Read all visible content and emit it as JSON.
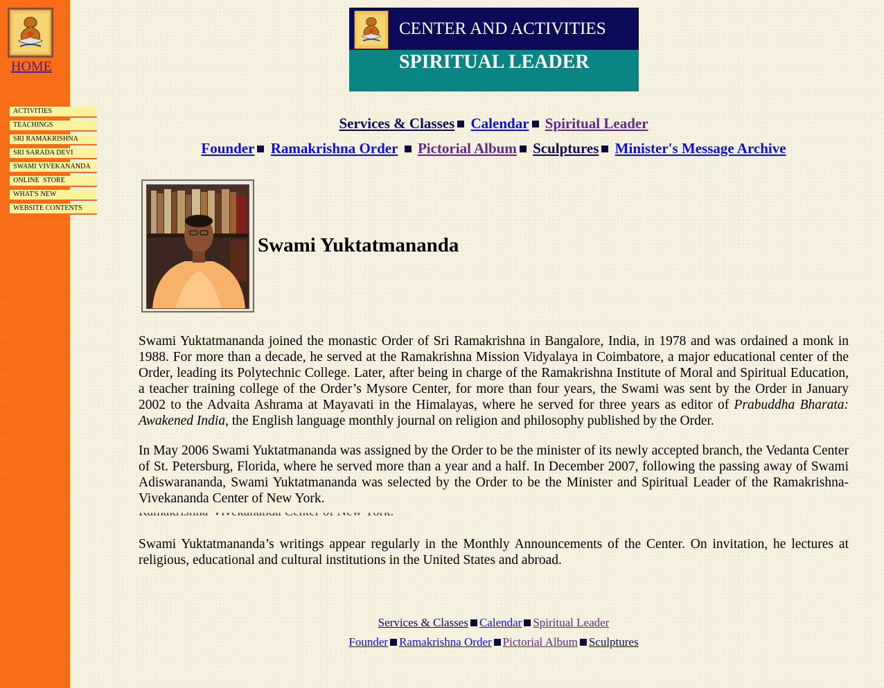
{
  "sidebar": {
    "home_label": "HOME",
    "menu": [
      "ACTIVITIES",
      "TEACHINGS",
      "SRI RAMAKRISHNA",
      "SRI SARADA DEVI",
      "SWAMI VIVEKANANDA",
      "ONLINE  STORE",
      "WHAT'S NEW",
      "WEBSITE CONTENTS"
    ]
  },
  "banner": {
    "line1": "CENTER AND ACTIVITIES",
    "line2": "SPIRITUAL LEADER"
  },
  "nav": {
    "services": "Services & Classes",
    "calendar": "Calendar",
    "spiritual_leader": "Spiritual Leader",
    "founder": "Founder",
    "ramakrishna_order": "Ramakrishna Order",
    "pictorial_album": "Pictorial Album",
    "sculptures": "Sculptures",
    "ministers_archive": "Minister's Message Archive"
  },
  "profile": {
    "name": "Swami Yuktatmananda"
  },
  "body": {
    "p1_a": "Swami Yuktatmananda joined the monastic Order of Sri Ramakrishna in Bangalore, India, in 1978 and was ordained a monk in 1988. For more than a decade, he served at the Ramakrishna Mission Vidyalaya in Coimbatore, a major educational center of the Order, leading its Polytechnic College. Later, after being in charge of the Ramakrishna Institute of Moral and Spiritual Education, a teacher training college of the Order’s Mysore Center, for more than four years, the Swami was sent by the Order in January 2002 to the Advaita Ashrama at Mayavati in the Himalayas, where he served for three years as editor of ",
    "p1_italic": "Prabuddha Bharata: Awakened India",
    "p1_b": ", the English language monthly journal on religion and philosophy published by the Order.",
    "p2": "In May 2006 Swami Yuktatmananda was assigned by the Order to be the minister of its newly accepted branch, the Vedanta Center of St. Petersburg, Florida, where he served more than a year and a half. In December 2007, following the passing away of Swami Adiswarananda, Swami Yuktatmananda was selected by the Order to be the Minister and Spiritual Leader of the Ramakrishna-Vivekananda Center of New York.",
    "ghost": "Ramakrishna-Vivekananda Center of New York.",
    "p3": "Swami Yuktatmananda’s writings appear regularly in the Monthly Announcements of the Center. On invitation, he lectures at religious, educational and cultural institutions in the United States and abroad."
  },
  "footer": {
    "services": "Services & Classes",
    "calendar": "Calendar",
    "spiritual_leader": "Spiritual Leader",
    "founder": "Founder",
    "ramakrishna_order": "Ramakrishna Order",
    "pictorial_album": "Pictorial Album",
    "sculptures": "Sculptures"
  },
  "colors": {
    "sidebar": "#f86a14",
    "menu_item": "#fbf39c",
    "banner_top": "#0b0b5a",
    "banner_bottom": "#0b8583",
    "link_blue": "#0a0ee8",
    "link_navy": "#0b0b5a",
    "link_visited": "#60298b"
  },
  "icons": [
    "emblem-logo-icon",
    "swami-photo",
    "square-separator-icon"
  ]
}
